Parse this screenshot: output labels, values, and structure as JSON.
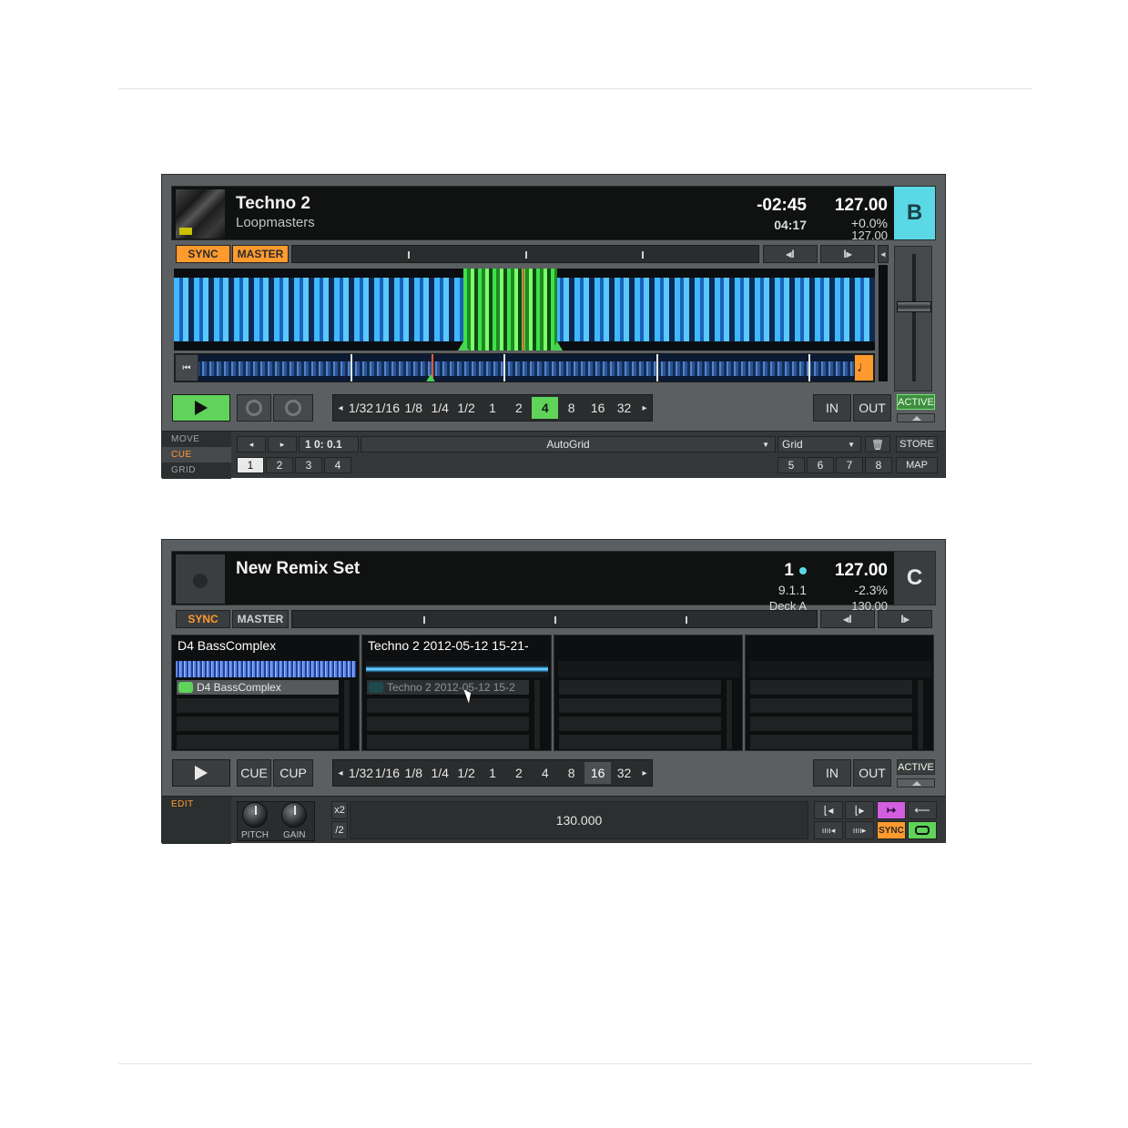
{
  "deck_b": {
    "title": "Techno 2",
    "artist": "Loopmasters",
    "remaining": "-02:45",
    "length": "04:17",
    "bpm": "127.00",
    "pitch": "+0.0%",
    "base_bpm": "127.00",
    "letter": "B",
    "sync": "SYNC",
    "master": "MASTER",
    "jump_back": "◂I",
    "jump_fwd": "I▸",
    "loop_sizes": [
      "1/32",
      "1/16",
      "1/8",
      "1/4",
      "1/2",
      "1",
      "2",
      "4",
      "8",
      "16",
      "32"
    ],
    "in": "IN",
    "out": "OUT",
    "active": "ACTIVE",
    "modes": [
      "MOVE",
      "CUE",
      "GRID"
    ],
    "position": "1 0: 0.1",
    "cue_type": "AutoGrid",
    "grid": "Grid",
    "store": "STORE",
    "map": "MAP",
    "hotcues": [
      "1",
      "2",
      "3",
      "4",
      "5",
      "6",
      "7",
      "8"
    ],
    "colors": {
      "accent": "#ff9a2e",
      "letter_bg": "#5ad8e6",
      "wave": "#3fb8ff",
      "play": "#5fd35a"
    }
  },
  "deck_c": {
    "title": "New Remix Set",
    "beat": "1",
    "position": "9.1.1",
    "source": "Deck A",
    "bpm": "127.00",
    "pitch": "-2.3%",
    "base_bpm": "130.00",
    "letter": "C",
    "sync": "SYNC",
    "master": "MASTER",
    "jump_back": "◂I",
    "jump_fwd": "I▸",
    "slots": [
      {
        "name": "D4 BassComplex",
        "cell": "D4 BassComplex"
      },
      {
        "name": "Techno 2 2012-05-12 15-21-",
        "cell": "Techno 2 2012-05-12 15-2"
      },
      {
        "name": "",
        "cell": ""
      },
      {
        "name": "",
        "cell": ""
      }
    ],
    "cue": "CUE",
    "cup": "CUP",
    "loop_sizes": [
      "1/32",
      "1/16",
      "1/8",
      "1/4",
      "1/2",
      "1",
      "2",
      "4",
      "8",
      "16",
      "32"
    ],
    "in": "IN",
    "out": "OUT",
    "active": "ACTIVE",
    "edit": "EDIT",
    "pitch_knob": "PITCH",
    "gain_knob": "GAIN",
    "x2": "x2",
    "half": "/2",
    "tempo": "130.000",
    "small_sync": "SYNC",
    "colors": {
      "letter_bg": "#3a3d3f",
      "key_dot": "#5ad8e6",
      "slot_loop": "#5fd35a",
      "purple": "#d15fe0"
    }
  }
}
